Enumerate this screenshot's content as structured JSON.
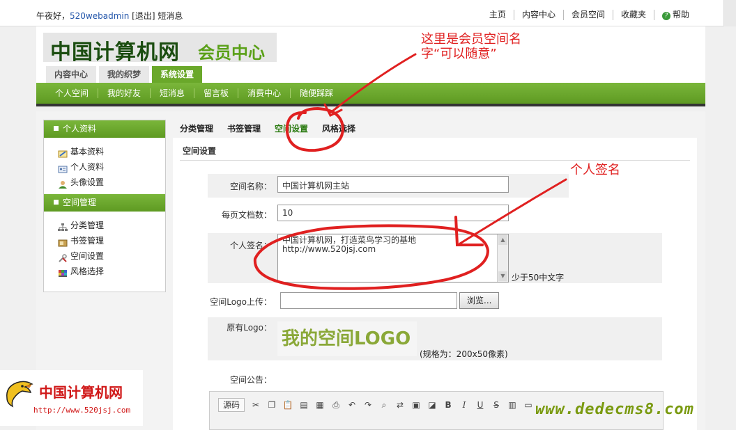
{
  "topbar": {
    "greeting": "午夜好，",
    "username": "520webadmin",
    "logout": "[退出]",
    "messages": "短消息",
    "nav": [
      "主页",
      "内容中心",
      "会员空间",
      "收藏夹"
    ],
    "help": "帮助"
  },
  "header": {
    "logo_main": "中国计算机网",
    "logo_sub": "会员中心",
    "main_tabs": [
      "内容中心",
      "我的织梦",
      "系统设置"
    ],
    "subnav": [
      "个人空间",
      "我的好友",
      "短消息",
      "留言板",
      "消费中心",
      "随便踩踩"
    ]
  },
  "sidebar": {
    "section1_title": "个人资料",
    "section1_items": [
      "基本资料",
      "个人资料",
      "头像设置"
    ],
    "section2_title": "空间管理",
    "section2_items": [
      "分类管理",
      "书签管理",
      "空间设置",
      "风格选择"
    ]
  },
  "panel": {
    "tabs": [
      "分类管理",
      "书签管理",
      "空间设置",
      "风格选择"
    ],
    "active_tab": "空间设置",
    "title": "空间设置",
    "space_name_label": "空间名称：",
    "space_name_value": "中国计算机网主站",
    "per_page_label": "每页文档数：",
    "per_page_value": "10",
    "signature_label": "个人签名：",
    "signature_line1": "中国计算机网，打造菜鸟学习的基地",
    "signature_line2": "http://www.520jsj.com",
    "signature_hint": "少于50中文字",
    "logo_upload_label": "空间Logo上传：",
    "browse_button": "浏览...",
    "old_logo_label": "原有Logo：",
    "old_logo_text": "我的空间LOGO",
    "logo_size_hint": "(规格为：200x50像素)",
    "notice_label": "空间公告：",
    "editor_source": "源码"
  },
  "annotations": {
    "note1_line1": "这里是会员空间名",
    "note1_line2": "字“可以随意”",
    "note2": "个人签名"
  },
  "watermarks": {
    "left_title": "中国计算机网",
    "left_url": "http://www.520jsj.com",
    "right": "www.dedecms8.com"
  },
  "colors": {
    "accent_green": "#6aa82a",
    "annotation_red": "#e02020"
  }
}
